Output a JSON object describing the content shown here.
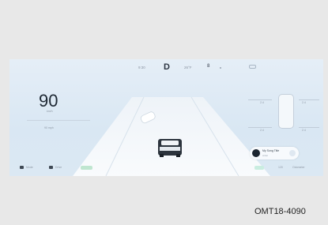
{
  "status_bar": {
    "time": "9:30",
    "gear": "D",
    "temperature": "26°F",
    "number": "8"
  },
  "speedometer": {
    "speed": "90",
    "unit": "km/h",
    "limit": "90 mph"
  },
  "tire_pressure": {
    "front_left": "2.4",
    "front_right": "2.4",
    "rear_left": "2.4",
    "rear_right": "2.4"
  },
  "media": {
    "title": "My Song Title",
    "artist": "Artist"
  },
  "bottom_bar": {
    "left_item_1": "Mode",
    "left_item_2": "Drive",
    "status_pill": "",
    "right_item_1": "120",
    "right_item_2": "Odometer"
  },
  "caption": "OMT18-4090",
  "colors": {
    "screen_bg": "#e3edf6",
    "road": "#f6f9fc",
    "text_dark": "#1e2833",
    "accent_green": "#bfe6d0"
  }
}
